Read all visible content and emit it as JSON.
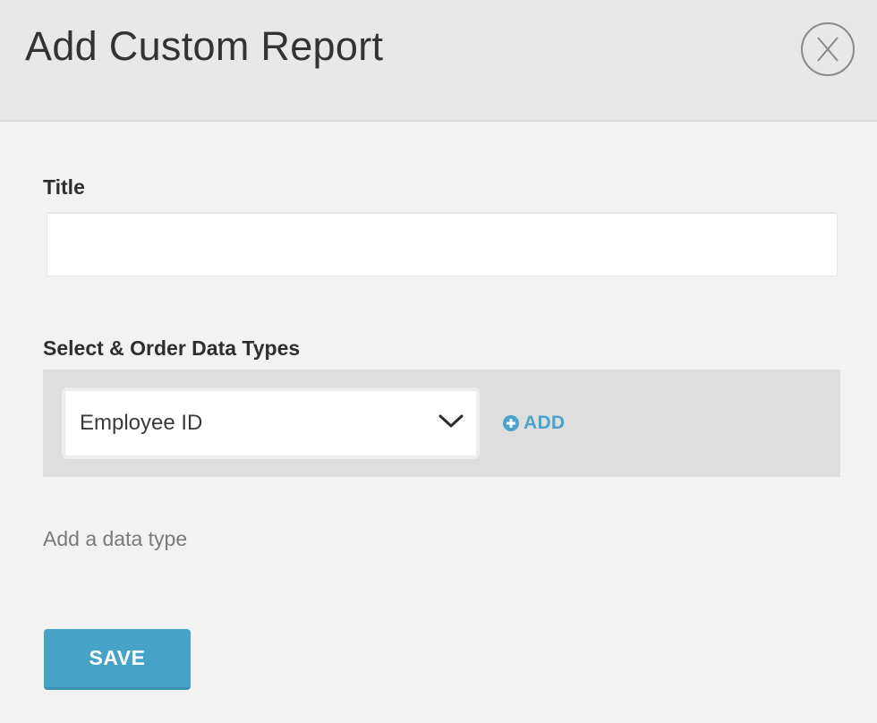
{
  "modal": {
    "title": "Add Custom Report",
    "close_label": "X"
  },
  "form": {
    "title_field": {
      "label": "Title",
      "value": "",
      "placeholder": ""
    },
    "data_types": {
      "label": "Select & Order Data Types",
      "selected": "Employee ID",
      "add_label": "ADD",
      "add_icon": "plus-circle-icon",
      "dropdown_icon": "chevron-down-icon",
      "helper_text": "Add a data type"
    },
    "save_label": "SAVE"
  },
  "colors": {
    "accent": "#46a3c7",
    "link": "#4aa3c8",
    "header_bg": "#e8e8e8",
    "body_bg": "#f2f2f2",
    "row_bg": "#dedede"
  }
}
